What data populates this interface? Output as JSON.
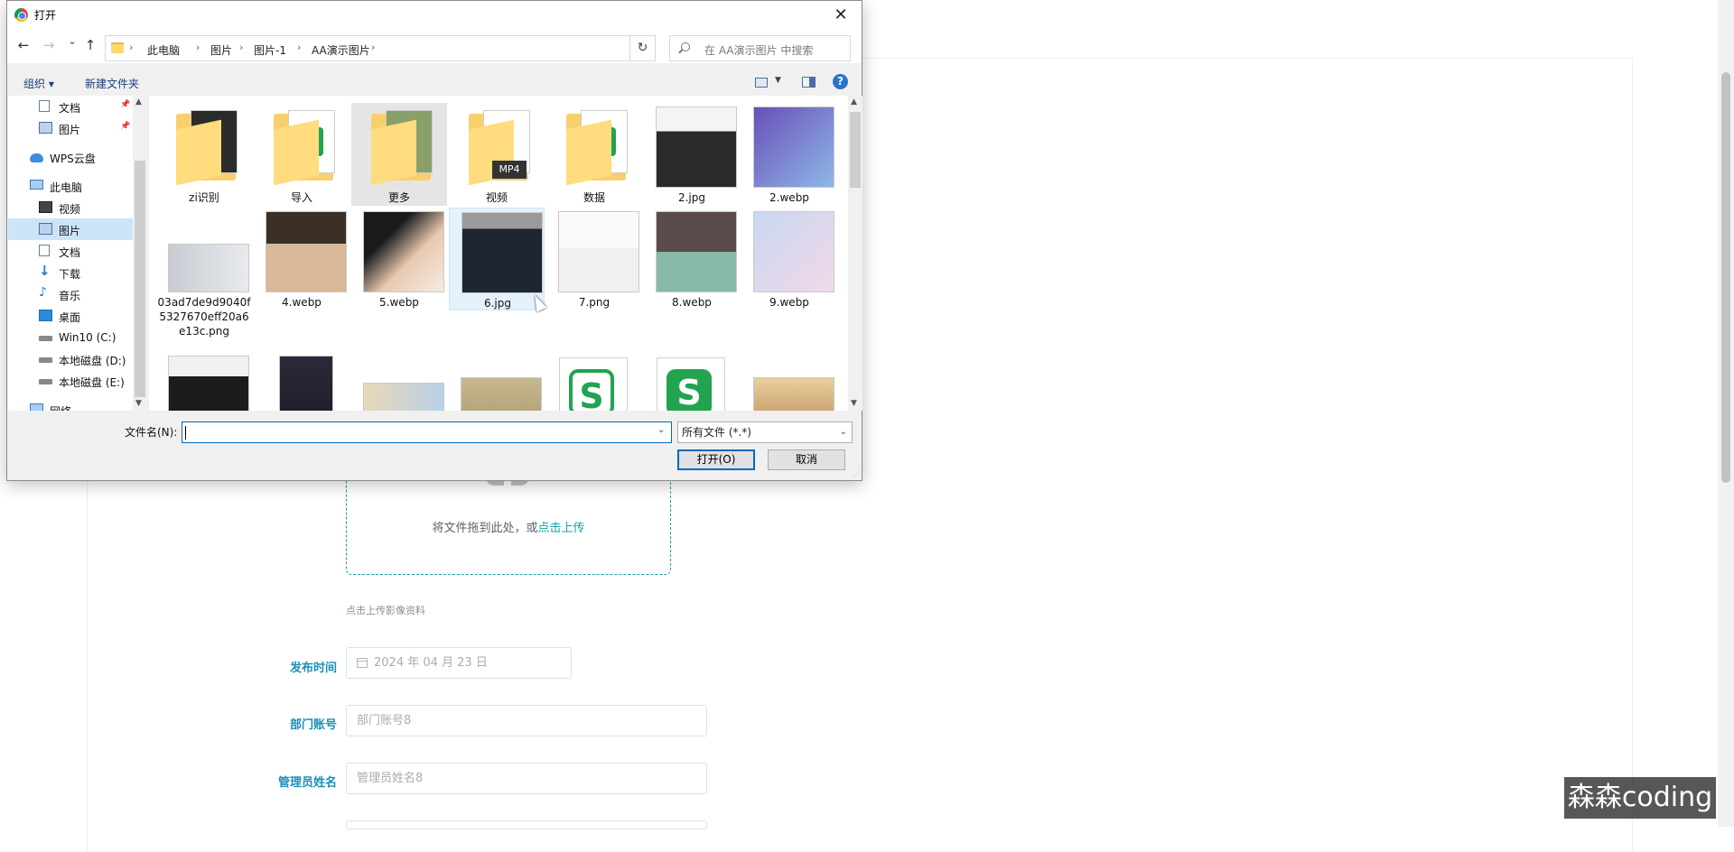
{
  "dialog": {
    "title": "打开",
    "close_label": "✕",
    "nav": {
      "back": "←",
      "forward": "→",
      "recent": "⌄",
      "up": "↑"
    },
    "breadcrumbs": [
      "此电脑",
      "图片",
      "图片-1",
      "AA演示图片"
    ],
    "crumb_sep": "›",
    "refresh": "↻",
    "search_placeholder": "在 AA演示图片 中搜索",
    "toolbar": {
      "organize": "组织 ▾",
      "new_folder": "新建文件夹",
      "help": "?"
    },
    "tree": [
      {
        "label": "文档",
        "icon": "document-icon",
        "pinned": true
      },
      {
        "label": "图片",
        "icon": "pictures-icon",
        "pinned": true
      },
      {
        "label": "WPS云盘",
        "icon": "cloud-icon"
      },
      {
        "label": "此电脑",
        "icon": "computer-icon"
      },
      {
        "label": "视频",
        "icon": "video-icon"
      },
      {
        "label": "图片",
        "icon": "pictures-icon",
        "selected": true
      },
      {
        "label": "文档",
        "icon": "document-icon"
      },
      {
        "label": "下载",
        "icon": "download-icon"
      },
      {
        "label": "音乐",
        "icon": "music-icon"
      },
      {
        "label": "桌面",
        "icon": "desktop-icon"
      },
      {
        "label": "Win10 (C:)",
        "icon": "drive-icon"
      },
      {
        "label": "本地磁盘 (D:)",
        "icon": "drive-icon"
      },
      {
        "label": "本地磁盘 (E:)",
        "icon": "drive-icon"
      },
      {
        "label": "网络",
        "icon": "network-icon"
      }
    ],
    "pin_glyph": "📌",
    "files": [
      {
        "name": "zi识别",
        "kind": "folder"
      },
      {
        "name": "导入",
        "kind": "folder"
      },
      {
        "name": "更多",
        "kind": "folder",
        "state": "hover"
      },
      {
        "name": "视频",
        "kind": "folder",
        "badge": "MP4"
      },
      {
        "name": "数据",
        "kind": "folder"
      },
      {
        "name": "2.jpg",
        "kind": "photo"
      },
      {
        "name": "2.webp",
        "kind": "photo"
      },
      {
        "name": "03ad7de9d9040f5327670eff20a6e13c.png",
        "kind": "photo"
      },
      {
        "name": "4.webp",
        "kind": "photo"
      },
      {
        "name": "5.webp",
        "kind": "photo"
      },
      {
        "name": "6.jpg",
        "kind": "photo",
        "state": "selected"
      },
      {
        "name": "7.png",
        "kind": "photo"
      },
      {
        "name": "8.webp",
        "kind": "photo"
      },
      {
        "name": "9.webp",
        "kind": "photo"
      },
      {
        "name": "",
        "kind": "photo"
      },
      {
        "name": "",
        "kind": "photo"
      },
      {
        "name": "",
        "kind": "photo"
      },
      {
        "name": "",
        "kind": "photo"
      },
      {
        "name": "",
        "kind": "wps-doc"
      },
      {
        "name": "",
        "kind": "wps-sheet"
      },
      {
        "name": "",
        "kind": "photo"
      }
    ],
    "wps_glyph": "S",
    "filename_label": "文件名(N):",
    "filename_value": "",
    "filetype_value": "所有文件 (*.*)",
    "open_label": "打开(O)",
    "cancel_label": "取消"
  },
  "form": {
    "upload_hint": "将文件拖到此处，或",
    "upload_link": "点击上传",
    "upload_tip": "点击上传影像资料",
    "fields": [
      {
        "label": "发布时间",
        "placeholder": "2024 年 04 月 23 日"
      },
      {
        "label": "部门账号",
        "placeholder": "部门账号8"
      },
      {
        "label": "管理员姓名",
        "placeholder": "管理员姓名8"
      }
    ]
  },
  "watermark": "森森coding",
  "colors": {
    "accent": "#13a0a6",
    "label": "#1a8fb8",
    "selection": "#cce4f7",
    "primary_border": "#0067c0"
  }
}
